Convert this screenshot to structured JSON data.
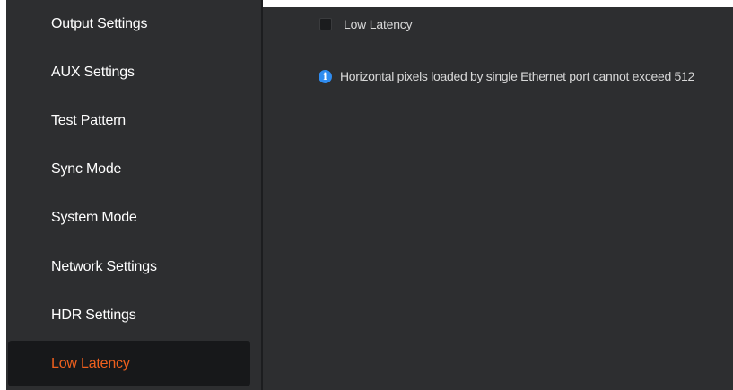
{
  "sidebar": {
    "items": [
      {
        "label": "Output Settings"
      },
      {
        "label": "AUX Settings"
      },
      {
        "label": "Test Pattern"
      },
      {
        "label": "Sync Mode"
      },
      {
        "label": "System Mode"
      },
      {
        "label": "Network Settings"
      },
      {
        "label": "HDR Settings"
      },
      {
        "label": "Low Latency",
        "active": true
      }
    ]
  },
  "main": {
    "low_latency_checkbox": {
      "label": "Low Latency",
      "checked": false
    },
    "info": {
      "icon": "info-icon",
      "text": "Horizontal pixels loaded by single Ethernet port cannot exceed 512"
    }
  },
  "colors": {
    "background": "#2d2e30",
    "active_item_bg": "#17181a",
    "accent": "#f0601e",
    "info_icon": "#2f8cf0",
    "text": "#ffffff"
  }
}
